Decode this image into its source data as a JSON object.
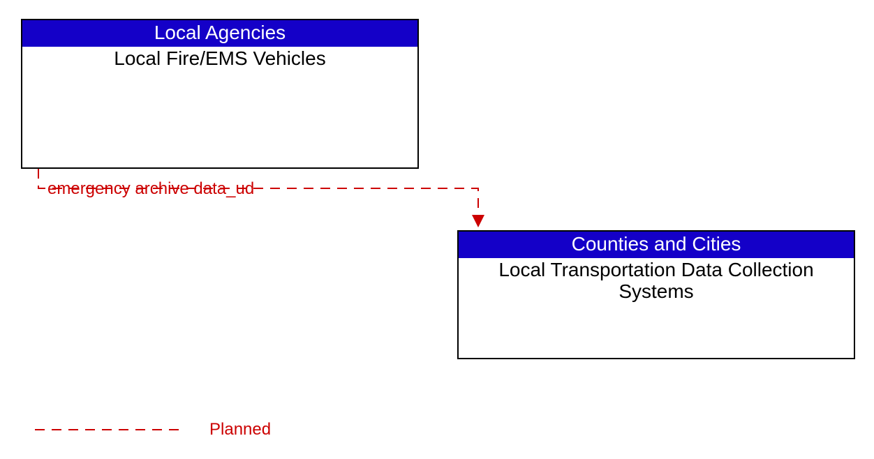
{
  "entities": {
    "top": {
      "header": "Local Agencies",
      "body": "Local Fire/EMS Vehicles"
    },
    "bottom": {
      "header": "Counties and Cities",
      "body": "Local Transportation Data Collection Systems"
    }
  },
  "flow": {
    "label": "emergency archive data_ud"
  },
  "legend": {
    "planned": "Planned"
  },
  "colors": {
    "header_bg": "#1400c8",
    "planned_line": "#cc0000"
  }
}
